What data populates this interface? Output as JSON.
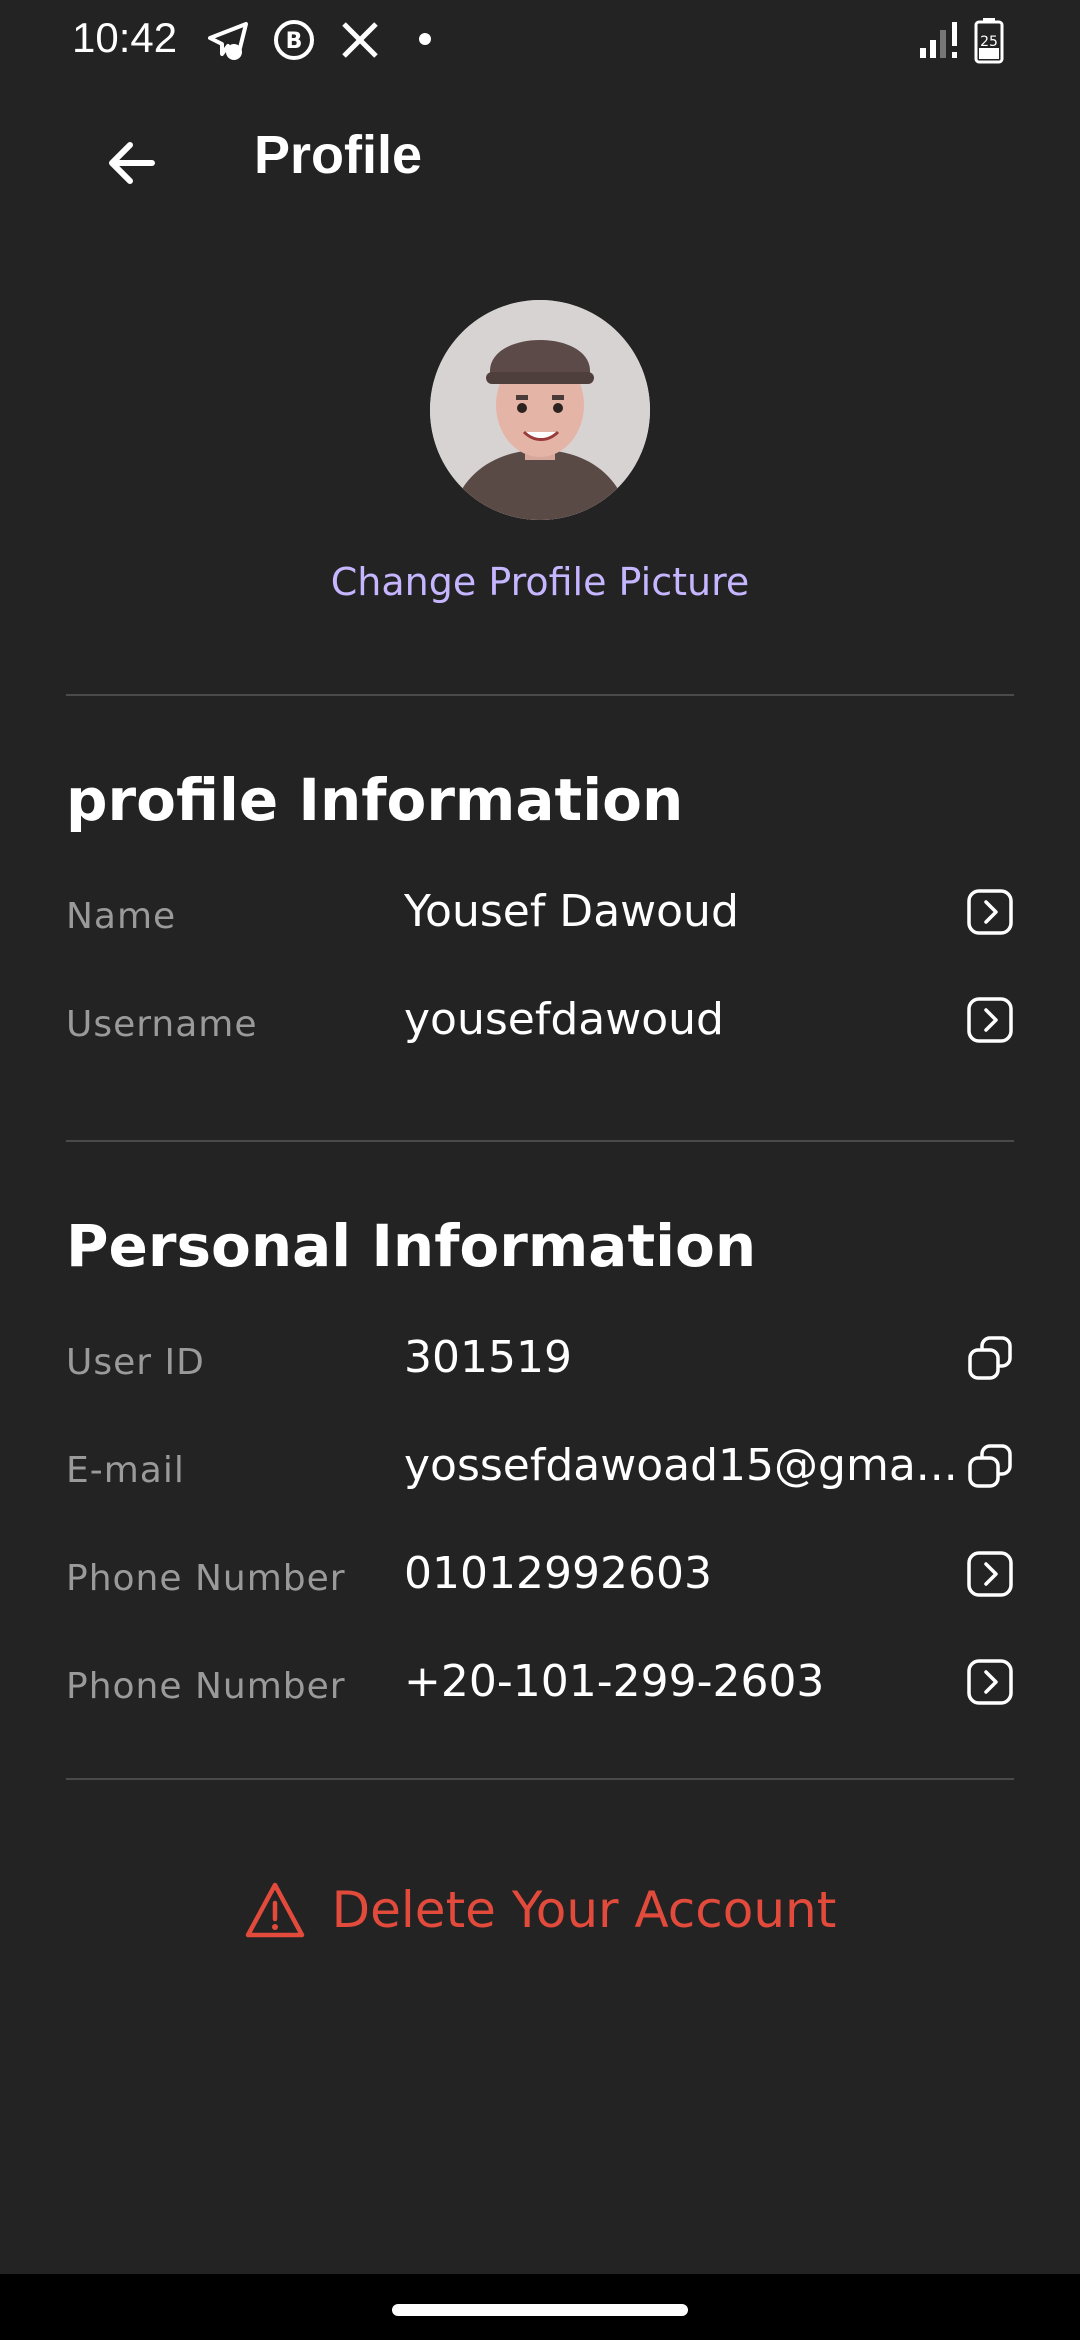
{
  "status_bar": {
    "time": "10:42",
    "icons": [
      "telegram-icon",
      "beeper-icon",
      "x-icon",
      "dot-icon"
    ],
    "right_icons": [
      "signal-icon",
      "battery-icon"
    ],
    "battery_level": "25"
  },
  "app_bar": {
    "title": "Profile",
    "back_icon": "arrow-left-icon"
  },
  "profile": {
    "change_picture_label": "Change Profile Picture"
  },
  "profile_info": {
    "title": "profile Information",
    "rows": [
      {
        "label": "Name",
        "value": "Yousef Dawoud",
        "action_icon": "chevron-right-box-icon"
      },
      {
        "label": "Username",
        "value": "yousefdawoud",
        "action_icon": "chevron-right-box-icon"
      }
    ]
  },
  "personal_info": {
    "title": "Personal Information",
    "rows": [
      {
        "label": "User ID",
        "value": "301519",
        "action_icon": "copy-icon"
      },
      {
        "label": "E-mail",
        "value": "yossefdawoad15@gma...",
        "action_icon": "copy-icon"
      },
      {
        "label": "Phone Number",
        "value": "01012992603",
        "action_icon": "chevron-right-box-icon"
      },
      {
        "label": "Phone Number",
        "value": "+20-101-299-2603",
        "action_icon": "chevron-right-box-icon"
      }
    ]
  },
  "delete_account": {
    "label": "Delete Your Account",
    "icon": "warning-icon",
    "color": "#e24a3b"
  },
  "colors": {
    "background": "#232323",
    "accent": "#c6b5ff",
    "danger": "#e24a3b"
  }
}
